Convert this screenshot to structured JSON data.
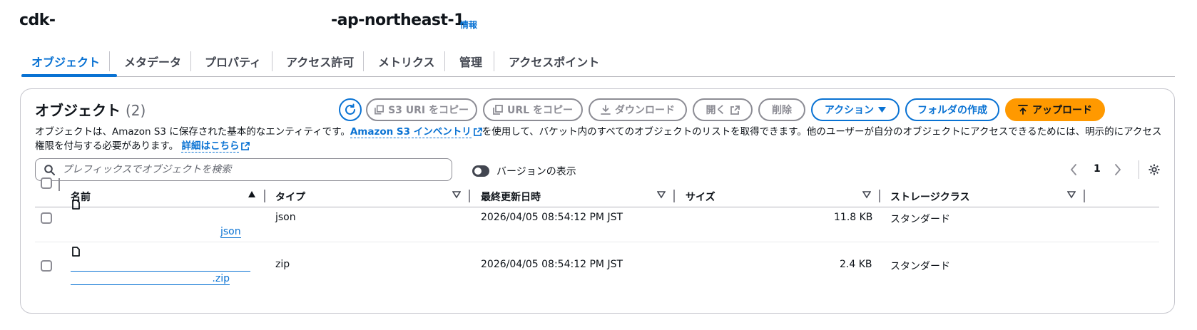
{
  "bucket": {
    "name_prefix": "cdk-",
    "name_suffix": "-ap-northeast-1",
    "info_label": "情報"
  },
  "tabs": [
    {
      "label": "オブジェクト",
      "active": true
    },
    {
      "label": "メタデータ",
      "active": false
    },
    {
      "label": "プロパティ",
      "active": false
    },
    {
      "label": "アクセス許可",
      "active": false
    },
    {
      "label": "メトリクス",
      "active": false
    },
    {
      "label": "管理",
      "active": false
    },
    {
      "label": "アクセスポイント",
      "active": false
    }
  ],
  "objects_panel": {
    "title": "オブジェクト",
    "count": "(2)",
    "buttons": {
      "refresh": "refresh",
      "copy_s3_uri": "S3 URI をコピー",
      "copy_url": "URL をコピー",
      "download": "ダウンロード",
      "open": "開く",
      "delete": "削除",
      "actions": "アクション",
      "create_folder": "フォルダの作成",
      "upload": "アップロード"
    },
    "description": {
      "part1": "オブジェクトは、Amazon S3 に保存された基本的なエンティティです。",
      "inventory_link": "Amazon S3 インベントリ",
      "part2": "を使用して、バケット内のすべてのオブジェクトのリストを取得できます。他のユーザーが自分のオブジェクトにアクセスできるためには、明示的にアクセス権限を付与する必要があります。",
      "learn_more_link": "詳細はこちら"
    },
    "search_placeholder": "プレフィックスでオブジェクトを検索",
    "version_toggle_label": "バージョンの表示",
    "version_toggle_on": false,
    "pagination": {
      "current_page": "1"
    },
    "columns": {
      "name": "名前",
      "type": "タイプ",
      "last_modified": "最終更新日時",
      "size": "サイズ",
      "storage_class": "ストレージクラス"
    },
    "rows": [
      {
        "name": "json",
        "type": "json",
        "last_modified": "2026/04/05 08:54:12 PM JST",
        "size": "11.8 KB",
        "storage_class": "スタンダード"
      },
      {
        "name": ".zip",
        "type": "zip",
        "last_modified": "2026/04/05 08:54:12 PM JST",
        "size": "2.4 KB",
        "storage_class": "スタンダード"
      }
    ]
  },
  "colors": {
    "accent": "#0972d3",
    "upload_button": "#ff9900",
    "disabled": "#8c8c94",
    "text": "#0f141a"
  },
  "icons": {
    "refresh": "refresh-icon",
    "copy": "copy-icon",
    "download": "download-icon",
    "external": "external-link-icon",
    "caret": "caret-down-icon",
    "upload": "upload-icon",
    "search": "search-icon",
    "file": "file-icon",
    "prev": "chevron-left-icon",
    "next": "chevron-right-icon",
    "settings": "gear-icon",
    "sort_asc": "sort-ascending-icon",
    "sort": "sort-icon"
  }
}
